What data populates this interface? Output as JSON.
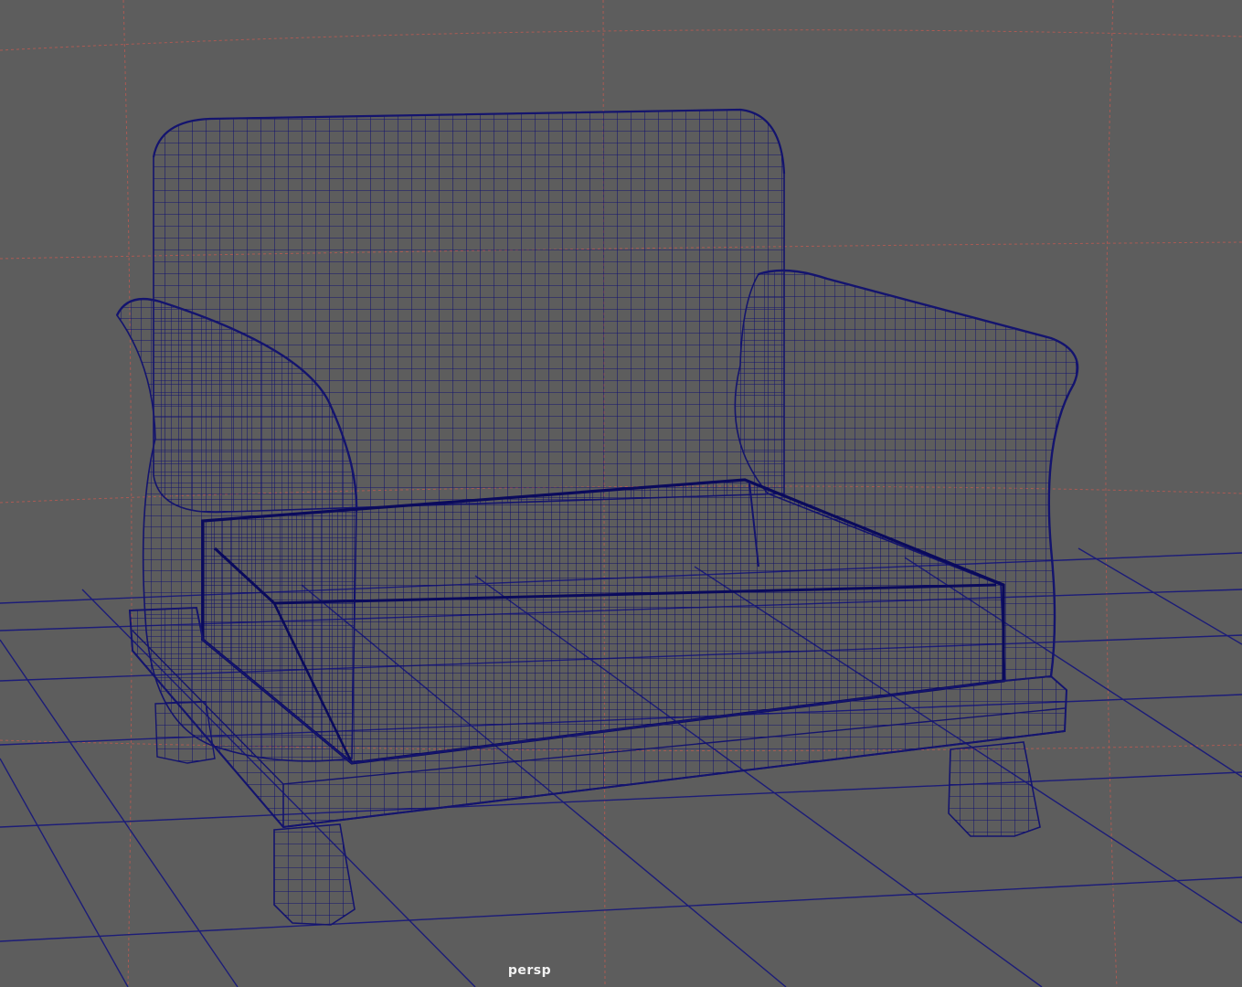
{
  "viewport": {
    "camera_label": "persp"
  },
  "colors": {
    "background": "#5d5d5d",
    "wireframe": "#14146e",
    "wireframe_dense": "#0a0a5c",
    "ground_grid": "#1c1c78",
    "guide_lines": "#b85a52"
  },
  "scene": {
    "object": "armchair-wireframe-mesh",
    "display_mode": "wireframe",
    "ground_grid": true
  }
}
